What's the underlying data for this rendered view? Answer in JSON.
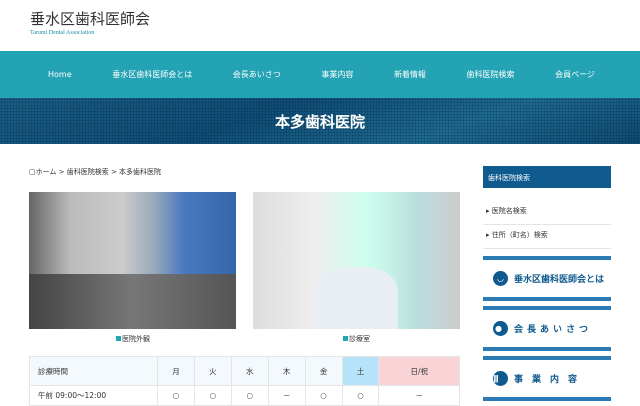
{
  "site": {
    "title": "垂水区歯科医師会",
    "subtitle": "Tarumi Dental Association"
  },
  "nav": [
    "Home",
    "垂水区歯科医師会とは",
    "会長あいさつ",
    "事業内容",
    "新着情報",
    "歯科医院検索",
    "会員ページ"
  ],
  "page_title": "本多歯科医院",
  "breadcrumb": "ホーム > 歯科医院検索 > 本多歯科医院",
  "photos": [
    {
      "caption": "医院外観"
    },
    {
      "caption": "診療室"
    }
  ],
  "schedule": {
    "headers": [
      "診療時間",
      "月",
      "火",
      "水",
      "木",
      "金",
      "土",
      "日/祝"
    ],
    "rows": [
      [
        "午前 09:00～12:00",
        "○",
        "○",
        "○",
        "－",
        "○",
        "○",
        "－"
      ]
    ]
  },
  "sidebar": {
    "heading": "歯科医院検索",
    "links": [
      "医院名検索",
      "住所（町名）検索"
    ],
    "banners": [
      "垂水区歯科医師会とは",
      "会長あいさつ",
      "事業内容"
    ]
  }
}
